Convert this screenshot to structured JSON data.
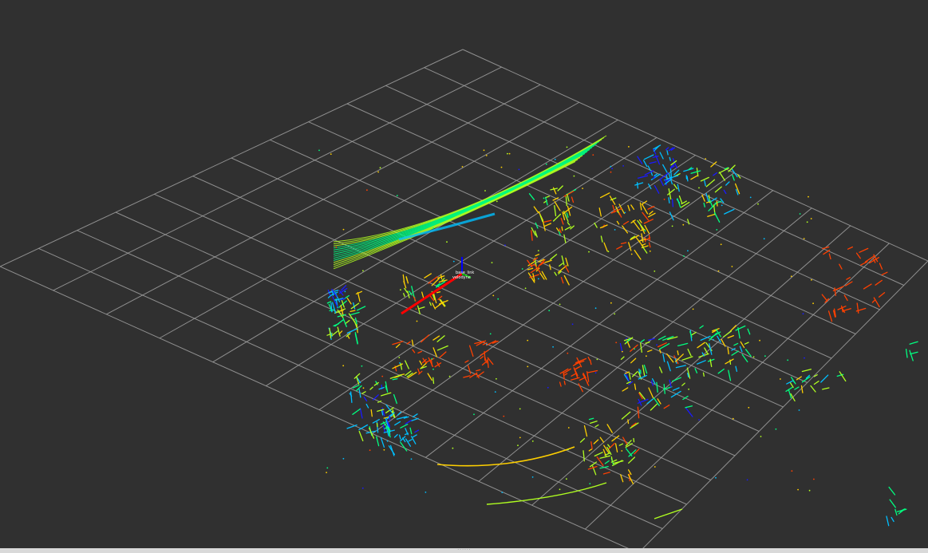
{
  "scene": {
    "background": "#303030",
    "grid_color": "#a0a0a0",
    "colormap": [
      "#1a1aff",
      "#00bfff",
      "#00ff80",
      "#b0ff20",
      "#ffd000",
      "#ff4000"
    ]
  },
  "frame": {
    "label_top": "base_link",
    "label_bottom": "velodyne",
    "axis_x_color": "#ff0000",
    "axis_y_color": "#00c000",
    "axis_z_color": "#0000ff"
  },
  "status_strip": {
    "grip": "······"
  }
}
